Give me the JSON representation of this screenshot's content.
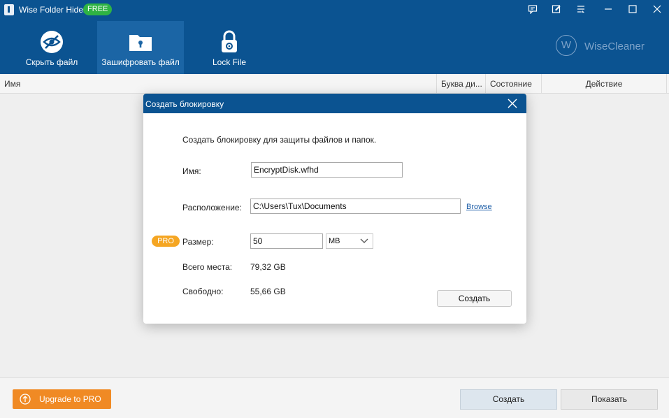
{
  "app": {
    "title": "Wise Folder Hider",
    "badge": "FREE"
  },
  "toolbar": {
    "items": [
      {
        "label": "Скрыть файл",
        "icon": "eye-slash-icon"
      },
      {
        "label": "Зашифровать файл",
        "icon": "folder-lock-icon",
        "active": true
      },
      {
        "label": "Lock File",
        "icon": "padlock-icon"
      }
    ]
  },
  "brand": {
    "name": "WiseCleaner",
    "logo_letter": "W"
  },
  "table": {
    "columns": [
      "Имя",
      "Буква ди...",
      "Состояние",
      "Действие"
    ]
  },
  "footer": {
    "upgrade_label": "Upgrade to PRO",
    "create_label": "Создать",
    "show_label": "Показать"
  },
  "dialog": {
    "title": "Создать блокировку",
    "description": "Создать блокировку для защиты файлов и папок.",
    "name_label": "Имя:",
    "name_value": "EncryptDisk.wfhd",
    "location_label": "Расположение:",
    "location_value": "C:\\Users\\Tux\\Documents",
    "browse_label": "Browse",
    "pro_badge": "PRO",
    "size_label": "Размер:",
    "size_value": "50",
    "size_unit": "MB",
    "total_label": "Всего места:",
    "total_value": "79,32 GB",
    "free_label": "Свободно:",
    "free_value": "55,66 GB",
    "create_label": "Создать"
  },
  "colors": {
    "header_bg": "#0b5391",
    "active_tab_bg": "#1b65a5",
    "free_badge": "#2fb344",
    "upgrade": "#f08a24",
    "pro_badge": "#f5a623"
  }
}
